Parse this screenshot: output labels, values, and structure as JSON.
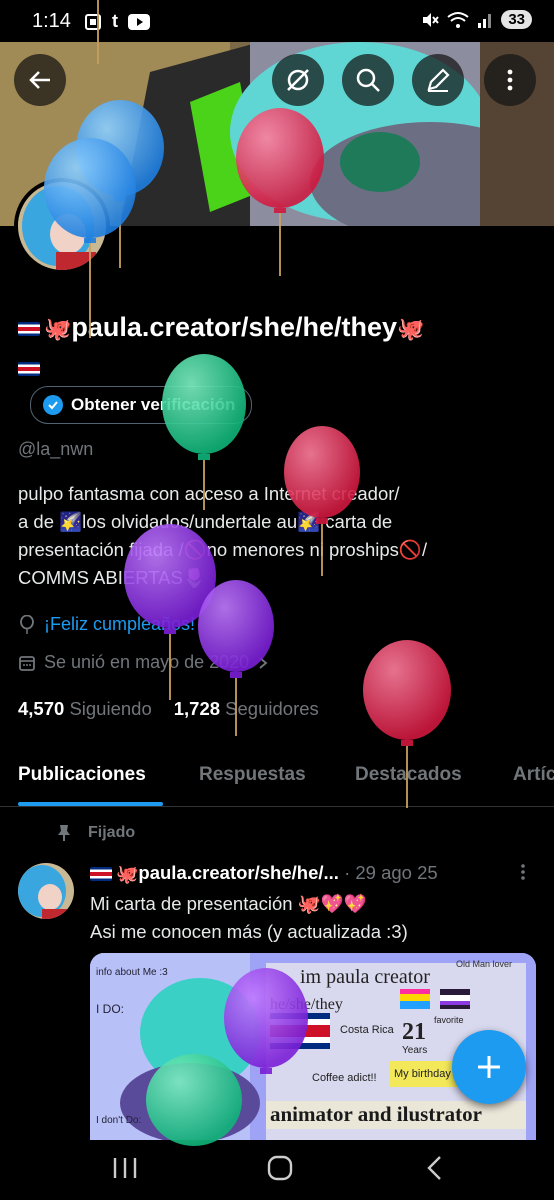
{
  "status_bar": {
    "time": "1:14",
    "battery": "33"
  },
  "profile": {
    "display_name": "paula.creator/she/he/they",
    "verify_label": "Obtener verificación",
    "handle": "@la_nwn",
    "bio_lines": [
      "pulpo fantasma con acceso a Internet  creador/",
      "a de  🌠los olvidados/undertale au🌠 carta de",
      "presentación  fijada  /🚫no menores ni proships🚫/",
      "COMMS ABIERTAS🌷"
    ],
    "birthday": "¡Feliz cumpleaños!",
    "joined": "Se unió en mayo de 2020",
    "following_count": "4,570",
    "following_label": "Siguiendo",
    "followers_count": "1,728",
    "followers_label": "Seguidores"
  },
  "tabs": [
    "Publicaciones",
    "Respuestas",
    "Destacados",
    "Artíc"
  ],
  "pinned_label": "Fijado",
  "post": {
    "author": "paula.creator/she/he/...",
    "date": "· 29 ago 25",
    "text_line1": "Mi carta de presentación 🐙💖💖",
    "text_line2": "Asi me conocen más (y actualizada  :3)",
    "image_text": {
      "title": "im paula creator",
      "pronouns": "he/she/they",
      "info": "info about Me :3",
      "number": "21",
      "years": "Years",
      "costa": "Costa Rica",
      "coffee": "Coffee adict!!",
      "birthday": "My birthday",
      "footer": "animator and ilustrator",
      "doodle1": "I DO:",
      "doodle2": "I don't Do:",
      "oldman": "Old Man lover",
      "favorite": "favorite"
    }
  },
  "colors": {
    "accent": "#1d9bf0",
    "balloon_blue": "#2f8fe0",
    "balloon_red": "#e0274f",
    "balloon_green": "#1fc98a",
    "balloon_purple": "#8a2be2"
  }
}
